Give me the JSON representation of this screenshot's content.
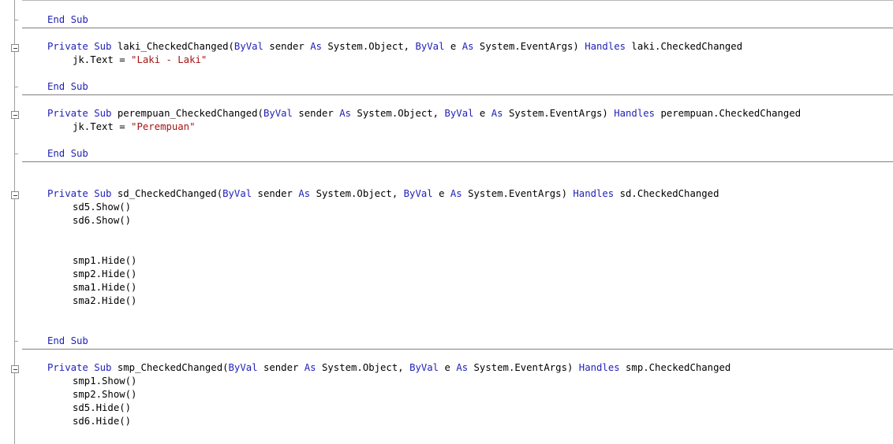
{
  "colors": {
    "keyword": "#1f1fb8",
    "string": "#a31515",
    "text": "#000000",
    "separator": "#808080"
  },
  "icons": {
    "fold": "collapse-box-minus-icon"
  },
  "code": {
    "l1": {
      "kw1": "End Sub"
    },
    "l2": {
      "kw1": "Private Sub",
      "t1": " laki_CheckedChanged(",
      "kw2": "ByVal",
      "t2": " sender ",
      "kw3": "As",
      "t3": " System.Object, ",
      "kw4": "ByVal",
      "t4": " e ",
      "kw5": "As",
      "t5": " System.EventArgs) ",
      "kw6": "Handles",
      "t6": " laki.CheckedChanged"
    },
    "l3": {
      "t1": "jk.Text = ",
      "str": "\"Laki - Laki\""
    },
    "l4": {
      "kw1": "End Sub"
    },
    "l5": {
      "kw1": "Private Sub",
      "t1": " perempuan_CheckedChanged(",
      "kw2": "ByVal",
      "t2": " sender ",
      "kw3": "As",
      "t3": " System.Object, ",
      "kw4": "ByVal",
      "t4": " e ",
      "kw5": "As",
      "t5": " System.EventArgs) ",
      "kw6": "Handles",
      "t6": " perempuan.CheckedChanged"
    },
    "l6": {
      "t1": "jk.Text = ",
      "str": "\"Perempuan\""
    },
    "l7": {
      "kw1": "End Sub"
    },
    "l8": {
      "kw1": "Private Sub",
      "t1": " sd_CheckedChanged(",
      "kw2": "ByVal",
      "t2": " sender ",
      "kw3": "As",
      "t3": " System.Object, ",
      "kw4": "ByVal",
      "t4": " e ",
      "kw5": "As",
      "t5": " System.EventArgs) ",
      "kw6": "Handles",
      "t6": " sd.CheckedChanged"
    },
    "l9": {
      "t1": "sd5.Show()"
    },
    "l10": {
      "t1": "sd6.Show()"
    },
    "l11": {
      "t1": "smp1.Hide()"
    },
    "l12": {
      "t1": "smp2.Hide()"
    },
    "l13": {
      "t1": "sma1.Hide()"
    },
    "l14": {
      "t1": "sma2.Hide()"
    },
    "l15": {
      "kw1": "End Sub"
    },
    "l16": {
      "kw1": "Private Sub",
      "t1": " smp_CheckedChanged(",
      "kw2": "ByVal",
      "t2": " sender ",
      "kw3": "As",
      "t3": " System.Object, ",
      "kw4": "ByVal",
      "t4": " e ",
      "kw5": "As",
      "t5": " System.EventArgs) ",
      "kw6": "Handles",
      "t6": " smp.CheckedChanged"
    },
    "l17": {
      "t1": "smp1.Show()"
    },
    "l18": {
      "t1": "smp2.Show()"
    },
    "l19": {
      "t1": "sd5.Hide()"
    },
    "l20": {
      "t1": "sd6.Hide()"
    }
  }
}
